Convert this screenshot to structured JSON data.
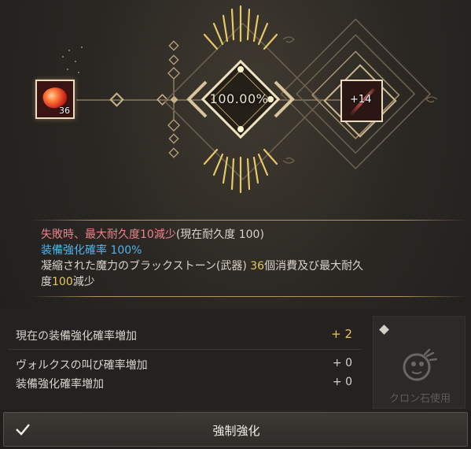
{
  "material": {
    "count": "36",
    "icon": "black-stone-weapon-icon"
  },
  "enhance": {
    "success_rate": "100.00%"
  },
  "target": {
    "level": "+14",
    "icon": "weapon-blade-icon"
  },
  "info": {
    "fail_main": "失敗時、最大耐久度10減少",
    "fail_paren": "(現在耐久度 100)",
    "rate_line": "装備強化確率 100%",
    "consume_pre": "凝縮された魔力のブラックストーン(武器) ",
    "consume_num": "36",
    "consume_mid": "個消費及び最大耐久",
    "consume_line2_pre": "度",
    "consume_line2_num": "100",
    "consume_line2_post": "減少"
  },
  "bonus": {
    "rows": [
      {
        "label": "現在の装備強化確率増加",
        "value": "+ 2"
      },
      {
        "label": "ヴォルクスの叫び確率増加",
        "value": "+ 0"
      },
      {
        "label": "装備強化確率増加",
        "value": "+ 0"
      }
    ]
  },
  "cron": {
    "label": "クロン石使用",
    "icon": "cron-stone-icon"
  },
  "action": {
    "label": "強制強化",
    "icon": "check-icon"
  },
  "colors": {
    "gold": "#e7c75a",
    "fail": "#e9828c",
    "rate": "#4fb3ea",
    "frame": "#e9dcc0"
  }
}
